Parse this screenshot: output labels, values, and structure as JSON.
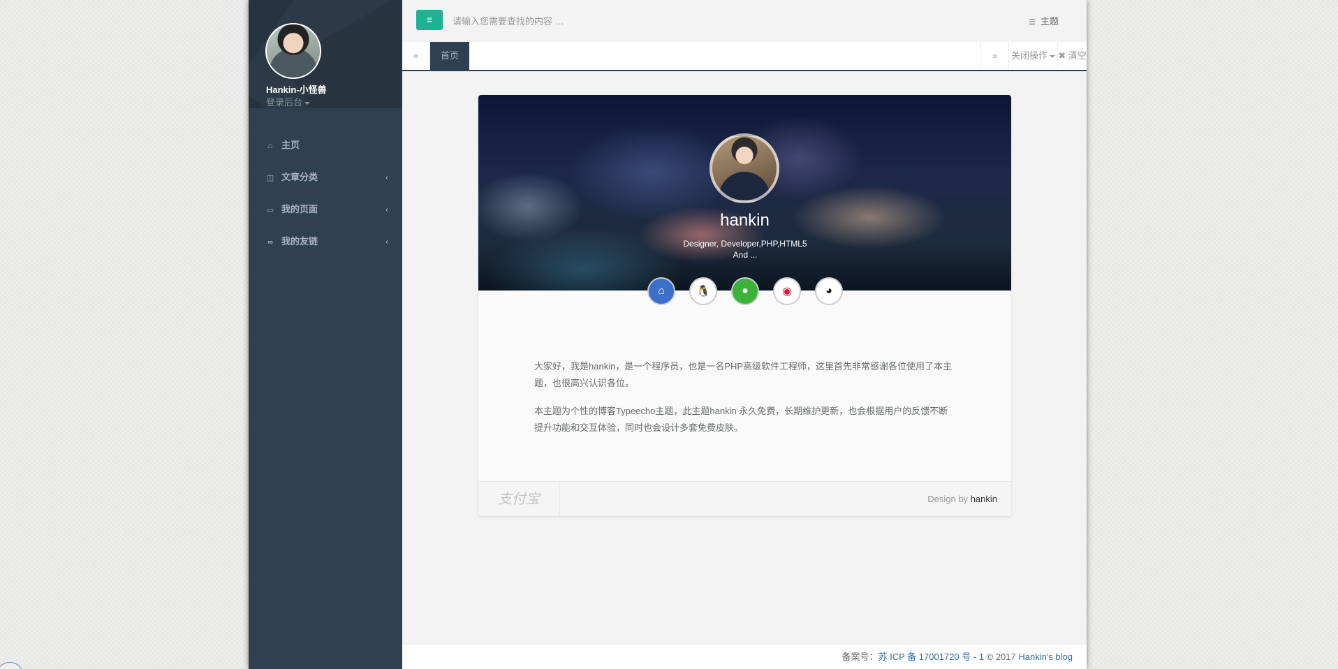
{
  "sidebar": {
    "user_name": "Hankin-小怪兽",
    "login_label": "登录后台",
    "items": [
      {
        "icon": "home-icon",
        "glyph": "⌂",
        "label": "主页",
        "arrow": ""
      },
      {
        "icon": "columns-icon",
        "glyph": "◫",
        "label": "文章分类",
        "arrow": "‹"
      },
      {
        "icon": "desktop-icon",
        "glyph": "▭",
        "label": "我的页面",
        "arrow": "‹"
      },
      {
        "icon": "link-icon",
        "glyph": "∞",
        "label": "我的友链",
        "arrow": "‹"
      }
    ]
  },
  "topbar": {
    "menu_glyph": "≡",
    "search_placeholder": "请输入您需要查找的内容 …",
    "theme_glyph": "☰",
    "theme_label": "主题"
  },
  "tabs": {
    "back_glyph": "«",
    "home_label": "首页",
    "forward_glyph": "»",
    "close_ops_label": "关闭操作",
    "clear_glyph": "✖",
    "clear_label": "清空"
  },
  "profile": {
    "name": "hankin",
    "desc_line1": "Designer, Developer,PHP,HTML5",
    "desc_line2": "And ...",
    "social": [
      {
        "icon": "home-icon",
        "glyph": "⌂"
      },
      {
        "icon": "qq-icon",
        "glyph": "🐧"
      },
      {
        "icon": "wechat-icon",
        "glyph": "●"
      },
      {
        "icon": "weibo-icon",
        "glyph": "◉"
      },
      {
        "icon": "github-icon",
        "glyph": "◕"
      }
    ],
    "paragraph1": "大家好，我是hankin，是一个程序员，也是一名PHP高级软件工程师，这里首先非常感谢各位使用了本主题，也很高兴认识各位。",
    "paragraph2": "本主题为个性的博客Typeecho主题，此主题hankin 永久免费，长期维护更新，也会根据用户的反馈不断提升功能和交互体验，同时也会设计多套免费皮肤。",
    "alipay_label": "支付宝",
    "design_by_prefix": "Design by",
    "design_by_author": "hankin"
  },
  "footer": {
    "icp_prefix": "备案号：",
    "icp_link": "苏 ICP 备 17001720 号 - 1",
    "copyright": " © 2017 ",
    "blog_link": "Hankin's blog"
  },
  "colors": {
    "sidebar_bg": "#2f4050",
    "accent": "#1ab394",
    "link": "#2e6da4"
  }
}
